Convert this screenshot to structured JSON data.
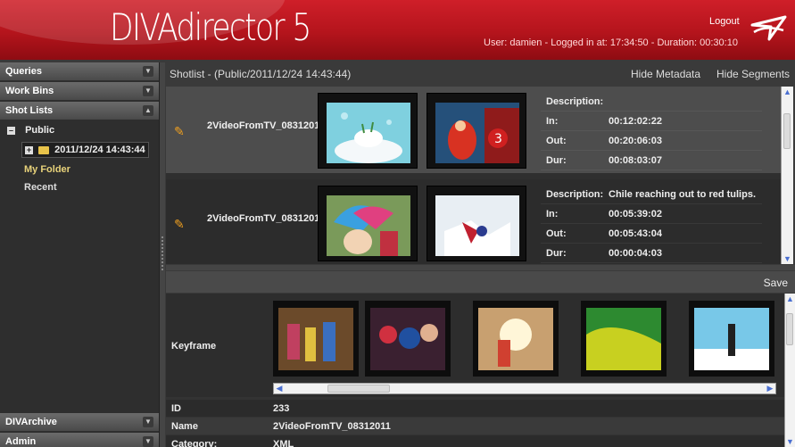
{
  "app": {
    "logo_prefix": "DIVA",
    "logo_suffix": "director",
    "logo_version": "5",
    "logout_label": "Logout",
    "user_info": "User: damien - Logged in at: 17:34:50 - Duration: 00:30:10"
  },
  "sidebar": {
    "sections": [
      {
        "label": "Queries"
      },
      {
        "label": "Work Bins"
      },
      {
        "label": "Shot Lists"
      }
    ],
    "tree": {
      "public_label": "Public",
      "selected_item": "2011/12/24 14:43:44",
      "my_folder": "My Folder",
      "recent": "Recent"
    },
    "bottom_sections": [
      {
        "label": "DIVArchive"
      },
      {
        "label": "Admin"
      }
    ]
  },
  "shotlist": {
    "title": "Shotlist - (Public/2011/12/24 14:43:44)",
    "hide_metadata_label": "Hide Metadata",
    "hide_segments_label": "Hide Segments",
    "labels": {
      "description": "Description:",
      "in": "In:",
      "out": "Out:",
      "dur": "Dur:"
    },
    "segments": [
      {
        "clip": "2VideoFromTV_0831201",
        "description": "",
        "in": "00:12:02:22",
        "out": "00:20:06:03",
        "dur": "00:08:03:07"
      },
      {
        "clip": "2VideoFromTV_0831201",
        "description": "Chile reaching out to red tulips.",
        "in": "00:05:39:02",
        "out": "00:05:43:04",
        "dur": "00:00:04:03"
      }
    ]
  },
  "metadata": {
    "save_label": "Save",
    "keyframe_label": "Keyframe",
    "fields": [
      {
        "key": "ID",
        "value": "233"
      },
      {
        "key": "Name",
        "value": "2VideoFromTV_08312011"
      },
      {
        "key": "Category:",
        "value": "XML"
      }
    ]
  },
  "colors": {
    "brand_red": "#c4171f",
    "pencil": "#f0a020",
    "folder": "#e8c34a"
  },
  "icons": [
    "chevron-down-icon",
    "chevron-up-icon",
    "pencil-icon",
    "folder-icon",
    "brand-logo-icon"
  ]
}
